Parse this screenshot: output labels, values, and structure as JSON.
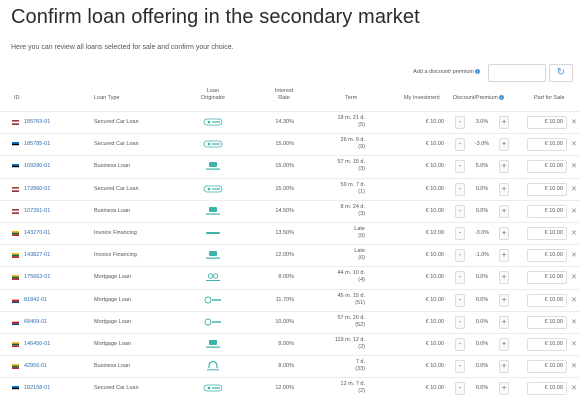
{
  "page": {
    "title": "Confirm loan offering in the secondary market",
    "subtitle": "Here you can review all loans selected for sale and confirm your choice."
  },
  "discount_control": {
    "label": "Add a discount/ premium",
    "input_value": "",
    "refresh_icon": "refresh-icon"
  },
  "columns": {
    "id": "ID",
    "loan_type": "Loan Type",
    "originator": "Loan Originator",
    "interest_rate": "Interest Rate",
    "term": "Term",
    "my_investment": "My Investment",
    "discount": "Discount/Premium",
    "part_for_sale": "Part for Sale"
  },
  "colors": {
    "link": "#2e6db4",
    "accent": "#4a90d9",
    "originator_teal": "#3bb3a9"
  },
  "rows": [
    {
      "flag": "latvia",
      "id": "185763-01",
      "loan_type": "Secured Car Loan",
      "originator": "mogo",
      "rate": "14.30%",
      "term1": "18 m. 21 d.",
      "term2": "(5)",
      "investment": "€ 10.00",
      "discount": "3.0%",
      "sale": "€ 10.00"
    },
    {
      "flag": "estonia",
      "id": "185785-01",
      "loan_type": "Secured Car Loan",
      "originator": "mogo",
      "rate": "15.00%",
      "term1": "26 m. 9 d.",
      "term2": "(9)",
      "investment": "€ 10.00",
      "discount": "-3.0%",
      "sale": "€ 10.00"
    },
    {
      "flag": "estonia",
      "id": "109280-01",
      "loan_type": "Business Loan",
      "originator": "business",
      "rate": "15.00%",
      "term1": "57 m. 15 d.",
      "term2": "(3)",
      "investment": "€ 10.00",
      "discount": "5.0%",
      "sale": "€ 10.00"
    },
    {
      "flag": "latvia",
      "id": "172860-01",
      "loan_type": "Secured Car Loan",
      "originator": "mogo",
      "rate": "15.00%",
      "term1": "59 m. 7 d.",
      "term2": "(1)",
      "investment": "€ 10.00",
      "discount": "0.0%",
      "sale": "€ 10.00"
    },
    {
      "flag": "latvia",
      "id": "107391-01",
      "loan_type": "Business Loan",
      "originator": "business",
      "rate": "14.50%",
      "term1": "8 m. 24 d.",
      "term2": "(3)",
      "investment": "€ 10.00",
      "discount": "0.0%",
      "sale": "€ 10.00"
    },
    {
      "flag": "lithuania",
      "id": "143270-01",
      "loan_type": "Invoice Financing",
      "originator": "invoice",
      "rate": "13.50%",
      "term1": "Late",
      "term2": "(0)",
      "investment": "€ 10.00",
      "discount": "-3.0%",
      "sale": "€ 10.00"
    },
    {
      "flag": "lithuania",
      "id": "143827-01",
      "loan_type": "Invoice Financing",
      "originator": "business",
      "rate": "12.00%",
      "term1": "Late",
      "term2": "(0)",
      "investment": "€ 10.00",
      "discount": "-1.0%",
      "sale": "€ 10.00"
    },
    {
      "flag": "lithuania",
      "id": "175663-01",
      "loan_type": "Mortgage Loan",
      "originator": "mortgage",
      "rate": "8.00%",
      "term1": "44 m. 10 d.",
      "term2": "(4)",
      "investment": "€ 10.00",
      "discount": "0.0%",
      "sale": "€ 10.00"
    },
    {
      "flag": "czech",
      "id": "81842-01",
      "loan_type": "Mortgage Loan",
      "originator": "ecm",
      "rate": "11.70%",
      "term1": "45 m. 15 d.",
      "term2": "(51)",
      "investment": "€ 10.00",
      "discount": "0.0%",
      "sale": "€ 10.00"
    },
    {
      "flag": "czech",
      "id": "68409-01",
      "loan_type": "Mortgage Loan",
      "originator": "ecm",
      "rate": "10.00%",
      "term1": "57 m. 20 d.",
      "term2": "(52)",
      "investment": "€ 10.00",
      "discount": "0.0%",
      "sale": "€ 10.00"
    },
    {
      "flag": "lithuania",
      "id": "146450-01",
      "loan_type": "Mortgage Loan",
      "originator": "business",
      "rate": "8.00%",
      "term1": "119 m. 12 d.",
      "term2": "(2)",
      "investment": "€ 10.00",
      "discount": "0.0%",
      "sale": "€ 10.00"
    },
    {
      "flag": "lithuania",
      "id": "42956-01",
      "loan_type": "Business Loan",
      "originator": "arch",
      "rate": "8.00%",
      "term1": "7 d.",
      "term2": "(33)",
      "investment": "€ 10.00",
      "discount": "0.0%",
      "sale": "€ 10.00"
    },
    {
      "flag": "estonia",
      "id": "182158-01",
      "loan_type": "Secured Car Loan",
      "originator": "mogo",
      "rate": "12.00%",
      "term1": "12 m. 7 d.",
      "term2": "(2)",
      "investment": "€ 10.00",
      "discount": "0.0%",
      "sale": "€ 10.00"
    }
  ]
}
